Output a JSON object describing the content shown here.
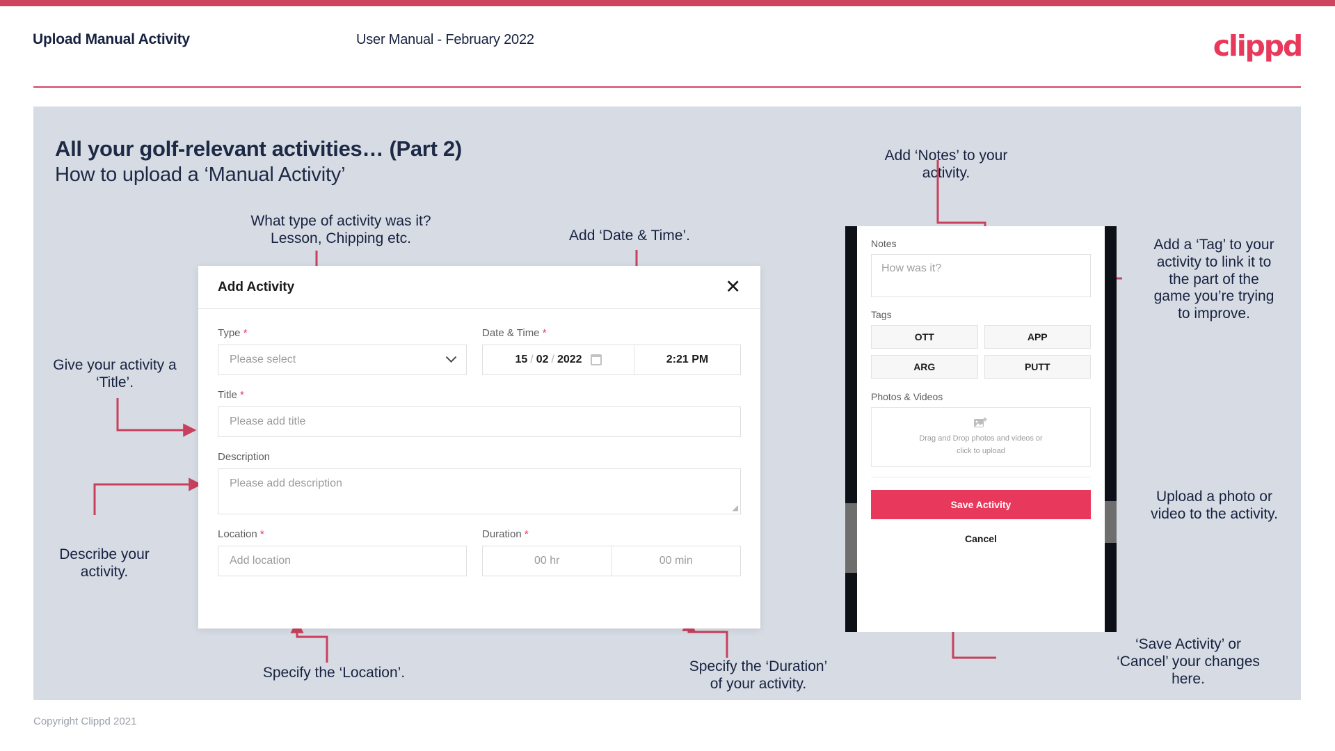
{
  "header": {
    "title": "Upload Manual Activity",
    "subtitle": "User Manual - February 2022",
    "logo": "clippd"
  },
  "slide": {
    "title": "All your golf-relevant activities… (Part 2)",
    "subtitle": "How to upload a ‘Manual Activity’"
  },
  "annotations": {
    "type": "What type of activity was it?\nLesson, Chipping etc.",
    "datetime": "Add ‘Date & Time’.",
    "title": "Give your activity a\n‘Title’.",
    "description": "Describe your\nactivity.",
    "location": "Specify the ‘Location’.",
    "duration": "Specify the ‘Duration’\nof your activity.",
    "notes": "Add ‘Notes’ to your\nactivity.",
    "tags": "Add a ‘Tag’ to your\nactivity to link it to\nthe part of the\ngame you’re trying\nto improve.",
    "photos": "Upload a photo or\nvideo to the activity.",
    "save": "‘Save Activity’ or\n‘Cancel’ your changes\nhere."
  },
  "dialog": {
    "title": "Add Activity",
    "close_icon": "close-icon",
    "fields": {
      "type": {
        "label": "Type",
        "required": "*",
        "placeholder": "Please select",
        "icon": "chevron-down-icon"
      },
      "datetime": {
        "label": "Date & Time",
        "required": "*",
        "day": "15",
        "sep1": "/",
        "month": "02",
        "sep2": "/",
        "year": "2022",
        "time": "2:21 PM",
        "icon": "calendar-icon"
      },
      "title": {
        "label": "Title",
        "required": "*",
        "placeholder": "Please add title"
      },
      "description": {
        "label": "Description",
        "required": "",
        "placeholder": "Please add description"
      },
      "location": {
        "label": "Location",
        "required": "*",
        "placeholder": "Add location"
      },
      "duration": {
        "label": "Duration",
        "required": "*",
        "hours": "00 hr",
        "minutes": "00 min"
      }
    }
  },
  "phone": {
    "notes": {
      "label": "Notes",
      "placeholder": "How was it?"
    },
    "tags": {
      "label": "Tags",
      "items": [
        "OTT",
        "APP",
        "ARG",
        "PUTT"
      ]
    },
    "photos": {
      "label": "Photos & Videos",
      "dropzone_line1": "Drag and Drop photos and videos or",
      "dropzone_line2": "click to upload",
      "icon": "image-upload-icon"
    },
    "save_label": "Save Activity",
    "cancel_label": "Cancel"
  },
  "footer": {
    "copyright": "Copyright Clippd 2021"
  },
  "colors": {
    "brand": "#e8385b",
    "accent_bar": "#cf445f",
    "panel": "#d7dce4",
    "ink": "#16213f",
    "arrow": "#c8405c"
  }
}
